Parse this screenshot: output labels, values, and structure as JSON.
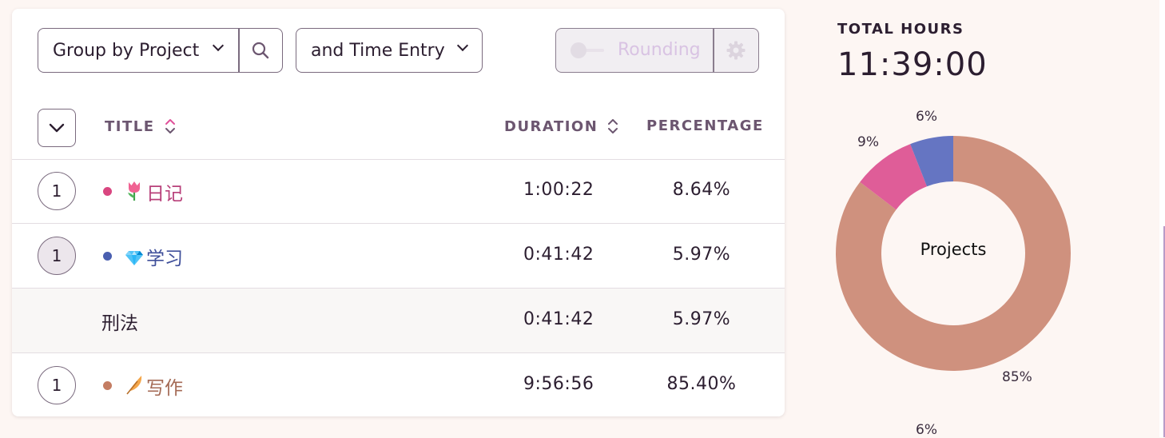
{
  "toolbar": {
    "group_by_label": "Group by Project",
    "secondary_group_label": "and Time Entry",
    "rounding_label": "Rounding"
  },
  "table": {
    "headers": {
      "title": "TITLE",
      "duration": "DURATION",
      "percentage": "PERCENTAGE"
    },
    "rows": [
      {
        "type": "project",
        "count": "1",
        "name": "日记",
        "emoji": "tulip",
        "color": "#d94680",
        "name_color": "#b8407a",
        "duration": "1:00:22",
        "percentage": "8.64%"
      },
      {
        "type": "project",
        "count": "1",
        "name": "学习",
        "emoji": "gem",
        "color": "#4a5fb0",
        "name_color": "#3f4f9a",
        "duration": "0:41:42",
        "percentage": "5.97%",
        "expanded": true
      },
      {
        "type": "entry",
        "name": "刑法",
        "duration": "0:41:42",
        "percentage": "5.97%"
      },
      {
        "type": "project",
        "count": "1",
        "name": "写作",
        "emoji": "feather",
        "color": "#c47d63",
        "name_color": "#a46a55",
        "duration": "9:56:56",
        "percentage": "85.40%"
      }
    ]
  },
  "summary": {
    "total_label": "TOTAL HOURS",
    "total_value": "11:39:00",
    "donut_center": "Projects",
    "extra_label": "6%"
  },
  "chart_data": {
    "type": "pie",
    "categories": [
      "写作",
      "日记",
      "学习"
    ],
    "values": [
      85.4,
      8.64,
      5.97
    ],
    "labels": [
      "85%",
      "9%",
      "6%"
    ],
    "colors": [
      "#cf917e",
      "#df5d98",
      "#6575c2"
    ]
  }
}
